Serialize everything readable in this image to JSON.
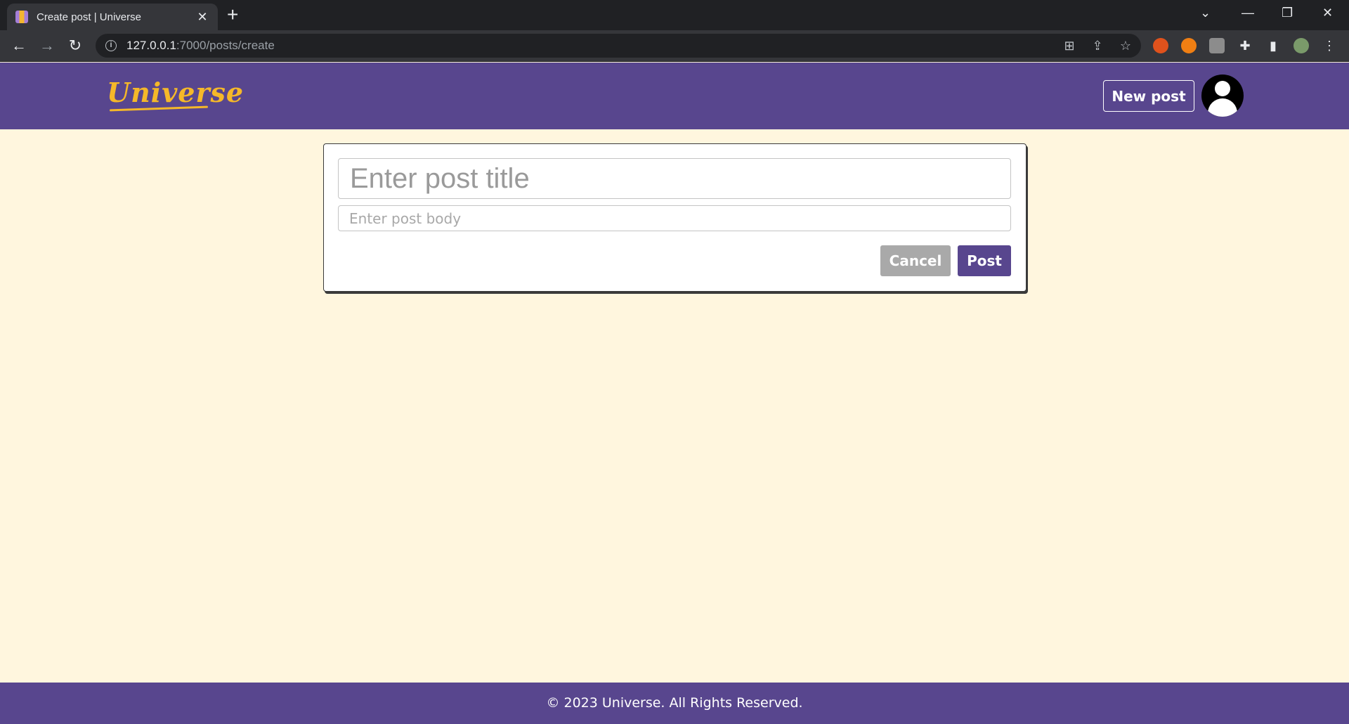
{
  "browser": {
    "tab_title": "Create post | Universe",
    "tab_close": "✕",
    "new_tab": "+",
    "url_host": "127.0.0.1",
    "url_path": ":7000/posts/create"
  },
  "header": {
    "logo_text": "Universe",
    "new_post_label": "New post"
  },
  "form": {
    "title_placeholder": "Enter post title",
    "title_value": "",
    "body_placeholder": "Enter post body",
    "body_value": "",
    "cancel_label": "Cancel",
    "post_label": "Post"
  },
  "footer": {
    "text": "© 2023 Universe. All Rights Reserved."
  },
  "colors": {
    "brand_purple": "#58468e",
    "logo_yellow": "#f5b829",
    "page_background": "#fff6de",
    "cancel_gray": "#a9a9a9"
  }
}
